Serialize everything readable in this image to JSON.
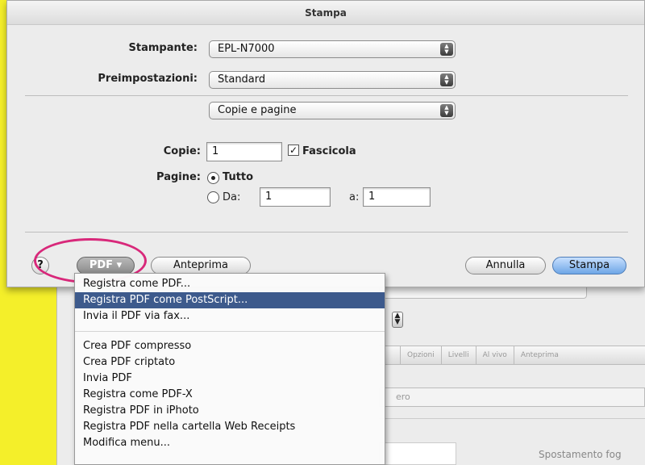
{
  "dialog": {
    "title": "Stampa",
    "printer_label": "Stampante:",
    "printer_value": "EPL-N7000",
    "presets_label": "Preimpostazioni:",
    "presets_value": "Standard",
    "section_value": "Copie e pagine",
    "copies_label": "Copie:",
    "copies_value": "1",
    "collate_label": "Fascicola",
    "collate_checked": true,
    "pages_label": "Pagine:",
    "all_label": "Tutto",
    "from_label": "Da:",
    "from_value": "1",
    "to_label": "a:",
    "to_value": "1",
    "help_label": "?",
    "pdf_label": "PDF ▾",
    "preview_label": "Anteprima",
    "cancel_label": "Annulla",
    "print_label": "Stampa"
  },
  "pdf_menu": {
    "items": [
      "Registra come PDF...",
      "Registra PDF come PostScript...",
      "Invia il PDF via fax...",
      "Crea PDF compresso",
      "Crea PDF criptato",
      "Invia PDF",
      "Registra come PDF-X",
      "Registra PDF in iPhoto",
      "Registra PDF nella cartella Web Receipts",
      "Modifica menu..."
    ],
    "selected_index": 1
  },
  "background": {
    "tabs": [
      "Opzioni",
      "Livelli",
      "Al vivo",
      "Anteprima"
    ],
    "field_text": "ero",
    "side_label": "Spostamento fog"
  },
  "colors": {
    "highlight": "#d8287a",
    "menu_selection": "#3d5a8c",
    "background_yellow": "#f4ef2a"
  }
}
